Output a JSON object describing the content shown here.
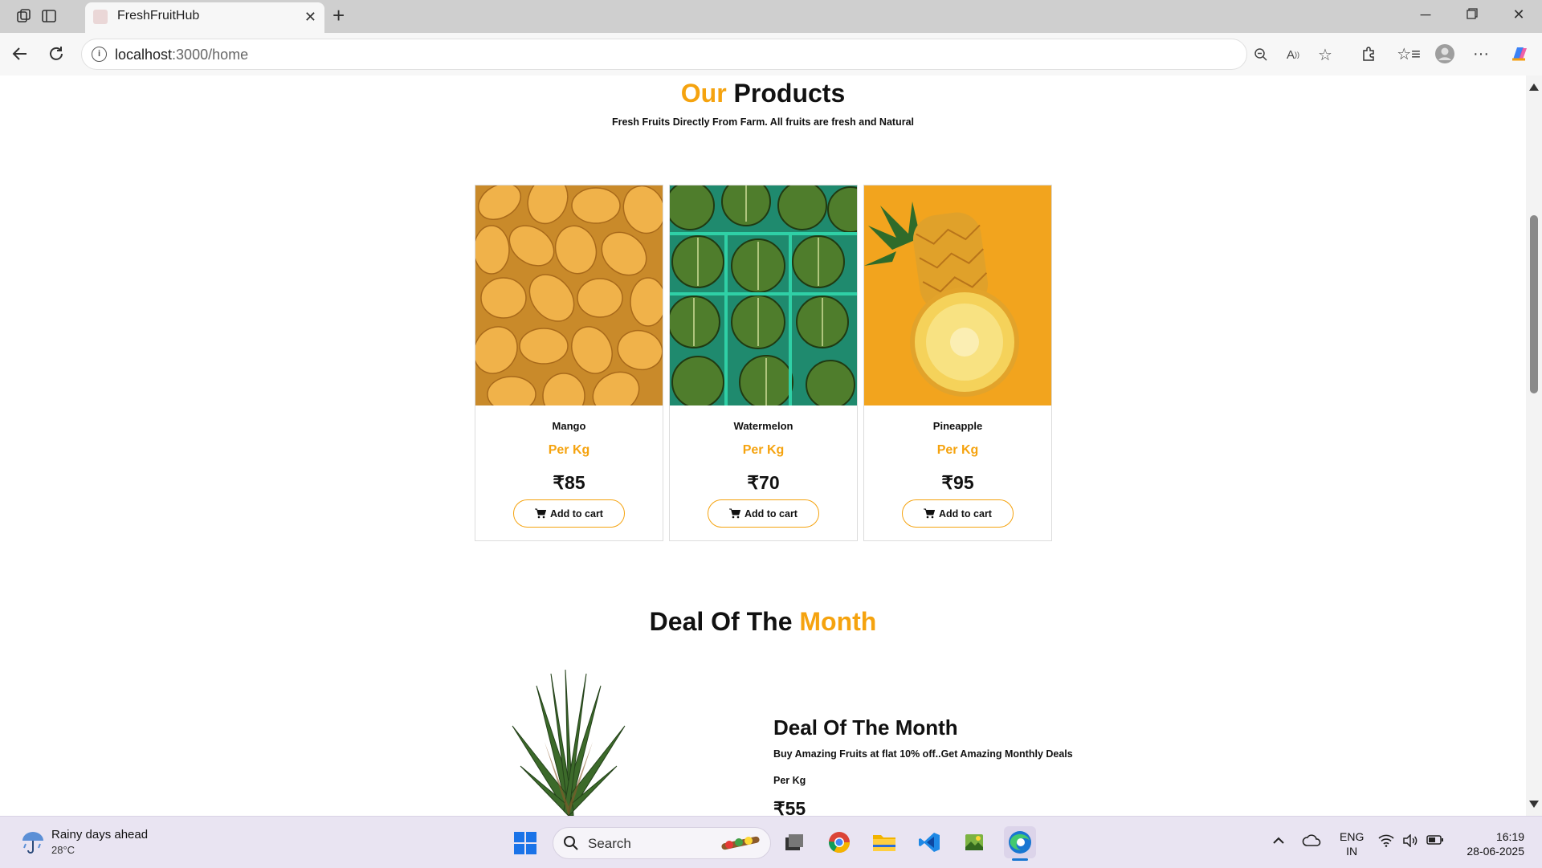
{
  "browser": {
    "tab_title": "FreshFruitHub",
    "url_host": "localhost",
    "url_rest": ":3000/home"
  },
  "page": {
    "heading_accent": "Our",
    "heading_main": "Products",
    "subtitle": "Fresh Fruits Directly From Farm. All fruits are fresh and Natural",
    "products": [
      {
        "name": "Mango",
        "unit": "Per Kg",
        "price": "₹85",
        "button": "Add to cart"
      },
      {
        "name": "Watermelon",
        "unit": "Per Kg",
        "price": "₹70",
        "button": "Add to cart"
      },
      {
        "name": "Pineapple",
        "unit": "Per Kg",
        "price": "₹95",
        "button": "Add to cart"
      }
    ],
    "deal_heading_main": "Deal Of The",
    "deal_heading_accent": "Month",
    "deal": {
      "title": "Deal Of The Month",
      "text": "Buy Amazing Fruits at flat 10% off..Get Amazing Monthly Deals",
      "unit": "Per Kg",
      "price": "₹55"
    }
  },
  "taskbar": {
    "weather_title": "Rainy days ahead",
    "weather_temp": "28°C",
    "search_label": "Search",
    "lang_1": "ENG",
    "lang_2": "IN",
    "time": "16:19",
    "date": "28-06-2025"
  },
  "colors": {
    "accent": "#f5a30f",
    "text": "#111111"
  }
}
